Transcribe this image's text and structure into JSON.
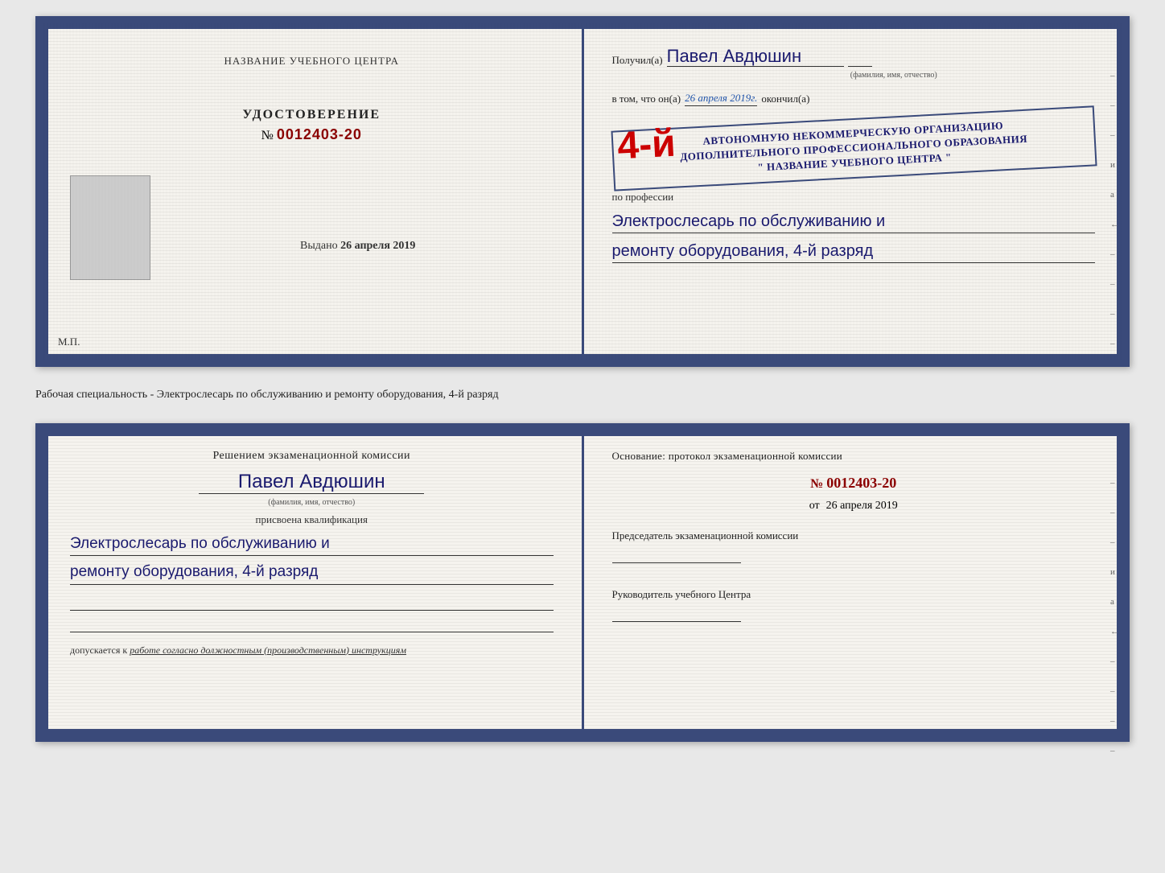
{
  "top_document": {
    "left_page": {
      "center_label": "НАЗВАНИЕ УЧЕБНОГО ЦЕНТРА",
      "udostoverenie_title": "УДОСТОВЕРЕНИЕ",
      "udostoverenie_number_prefix": "№",
      "udostoverenie_number": "0012403-20",
      "vydano_label": "Выдано",
      "vydano_date": "26 апреля 2019",
      "mp_label": "М.П."
    },
    "right_page": {
      "poluchil_label": "Получил(а)",
      "recipient_name": "Павел Авдюшин",
      "name_hint": "(фамилия, имя, отчество)",
      "vtom_label": "в том, что он(а)",
      "date_filled": "26 апреля 2019г.",
      "okoncil_label": "окончил(а)",
      "razryad_big": "4-й",
      "org_line1": "АВТОНОМНУЮ НЕКОММЕРЧЕСКУЮ ОРГАНИЗАЦИЮ",
      "org_line2": "ДОПОЛНИТЕЛЬНОГО ПРОФЕССИОНАЛЬНОГО ОБРАЗОВАНИЯ",
      "org_line3": "\" НАЗВАНИЕ УЧЕБНОГО ЦЕНТРА \"",
      "po_professii_label": "по профессии",
      "profession_line1": "Электрослесарь по обслуживанию и",
      "profession_line2": "ремонту оборудования, 4-й разряд"
    }
  },
  "separator": {
    "text": "Рабочая специальность - Электрослесарь по обслуживанию и ремонту оборудования, 4-й разряд"
  },
  "bottom_document": {
    "left_page": {
      "resheniem_label": "Решением экзаменационной комиссии",
      "person_name": "Павел Авдюшин",
      "name_hint": "(фамилия, имя, отчество)",
      "prisvoena_label": "присвоена квалификация",
      "qualification_line1": "Электрослесарь по обслуживанию и",
      "qualification_line2": "ремонту оборудования, 4-й разряд",
      "dopuskaetsya_prefix": "допускается к",
      "dopuskaetsya_text": "работе согласно должностным (производственным) инструкциям"
    },
    "right_page": {
      "osnovanie_label": "Основание: протокол экзаменационной комиссии",
      "proto_prefix": "№",
      "proto_number": "0012403-20",
      "ot_prefix": "от",
      "ot_date": "26 апреля 2019",
      "predsedatel_label": "Председатель экзаменационной комиссии",
      "rukovoditel_label": "Руководитель учебного Центра"
    }
  },
  "side_dashes": {
    "items": [
      "–",
      "–",
      "–",
      "и",
      "а",
      "←",
      "–",
      "–",
      "–",
      "–"
    ]
  }
}
